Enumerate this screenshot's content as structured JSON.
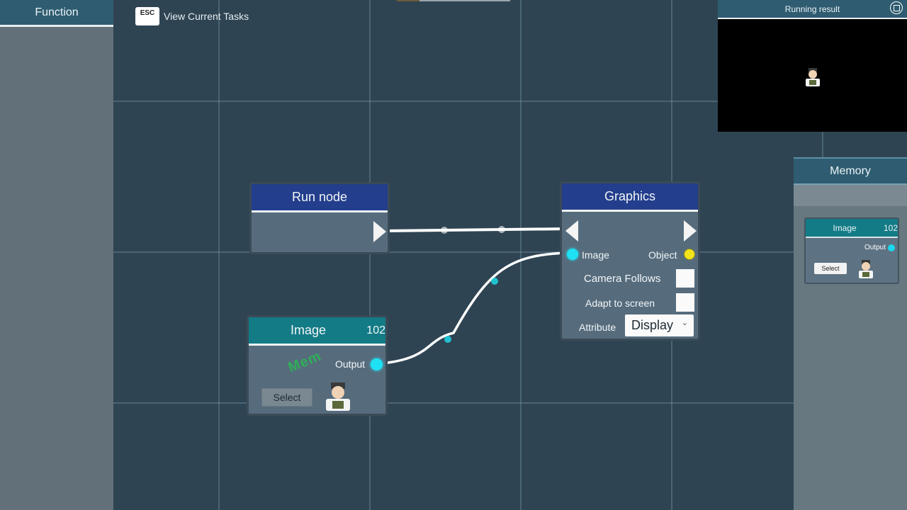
{
  "function_panel": {
    "title": "Function"
  },
  "esc_hint": {
    "key": "ESC",
    "label": "View Current Tasks"
  },
  "running_result": {
    "title": "Running result",
    "stop_icon": "stop-circle-icon"
  },
  "memory_panel": {
    "title": "Memory",
    "card": {
      "title": "Image",
      "number": "102",
      "output_label": "Output",
      "select_label": "Select"
    }
  },
  "nodes": {
    "run": {
      "title": "Run node"
    },
    "graphics": {
      "title": "Graphics",
      "image_label": "Image",
      "object_label": "Object",
      "camera_follows_label": "Camera Follows",
      "adapt_screen_label": "Adapt to screen",
      "attribute_label": "Attribute",
      "attribute_value": "Display"
    },
    "image": {
      "title": "Image",
      "number": "102",
      "output_label": "Output",
      "select_label": "Select"
    }
  },
  "colors": {
    "header_blue": "#233e8c",
    "header_teal": "#137b86",
    "port_cyan": "#1ee1f3",
    "port_yellow": "#f2e31a"
  }
}
